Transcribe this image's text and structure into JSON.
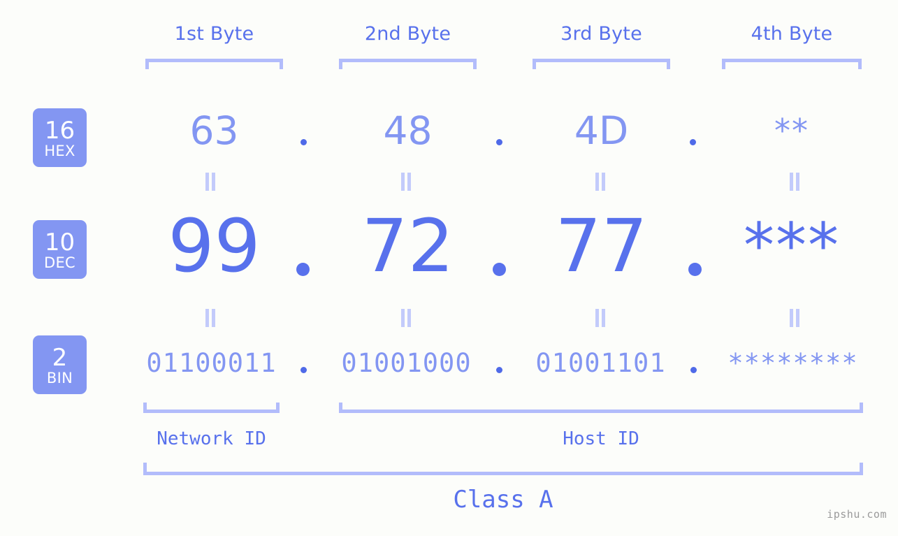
{
  "meta": {
    "background_color": "#fcfdfa",
    "accent_color": "#5871ec",
    "accent_light_color": "#8396f2",
    "bracket_color": "#b2bcfb",
    "eq_color": "#c3cbfb",
    "watermark": "ipshu.com"
  },
  "byte_headers": [
    {
      "label": "1st Byte"
    },
    {
      "label": "2nd Byte"
    },
    {
      "label": "3rd Byte"
    },
    {
      "label": "4th Byte"
    }
  ],
  "bases": [
    {
      "number": "16",
      "name": "HEX"
    },
    {
      "number": "10",
      "name": "DEC"
    },
    {
      "number": "2",
      "name": "BIN"
    }
  ],
  "rows": {
    "hex": {
      "base_number": "16",
      "base_name": "HEX",
      "values": [
        "63",
        "48",
        "4D",
        "**"
      ],
      "separator": "."
    },
    "dec": {
      "base_number": "10",
      "base_name": "DEC",
      "values": [
        "99",
        "72",
        "77",
        "***"
      ],
      "separator": "."
    },
    "bin": {
      "base_number": "2",
      "base_name": "BIN",
      "values": [
        "01100011",
        "01001000",
        "01001101",
        "********"
      ],
      "separator": "."
    }
  },
  "equals_marks": {
    "glyph": "||",
    "count_per_row": 4
  },
  "segments": {
    "network_id": "Network ID",
    "host_id": "Host ID",
    "class": "Class A"
  }
}
